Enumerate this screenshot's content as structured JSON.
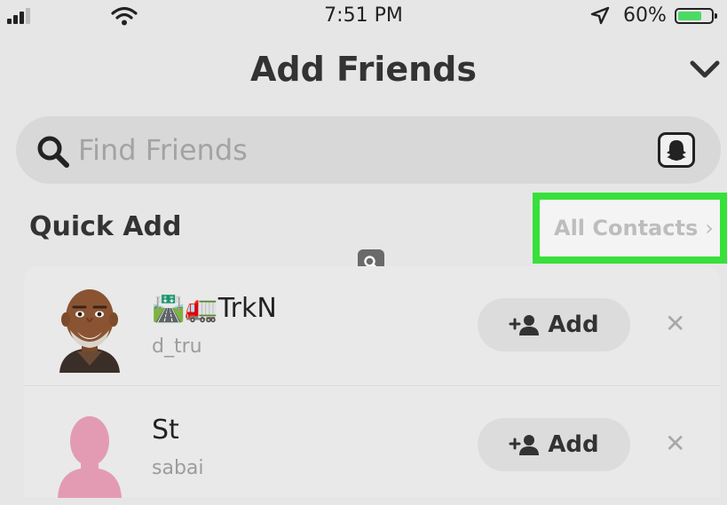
{
  "status_bar": {
    "time": "7:51 PM",
    "battery_percent": "60%",
    "battery_level": 0.6
  },
  "header": {
    "title": "Add Friends",
    "collapse_icon": "chevron-down-icon"
  },
  "search": {
    "placeholder": "Find Friends",
    "value": "",
    "icon": "search-icon",
    "action_icon": "ghost-icon"
  },
  "quick_add": {
    "title": "Quick Add",
    "all_contacts_label": "All Contacts",
    "highlight_color": "#37e03a",
    "items": [
      {
        "emoji": "🛣️🚛",
        "name": "TrkN",
        "username": "d_tru",
        "add_label": "Add"
      },
      {
        "emoji": "",
        "name": "St",
        "username": "sabai",
        "add_label": "Add"
      }
    ]
  }
}
